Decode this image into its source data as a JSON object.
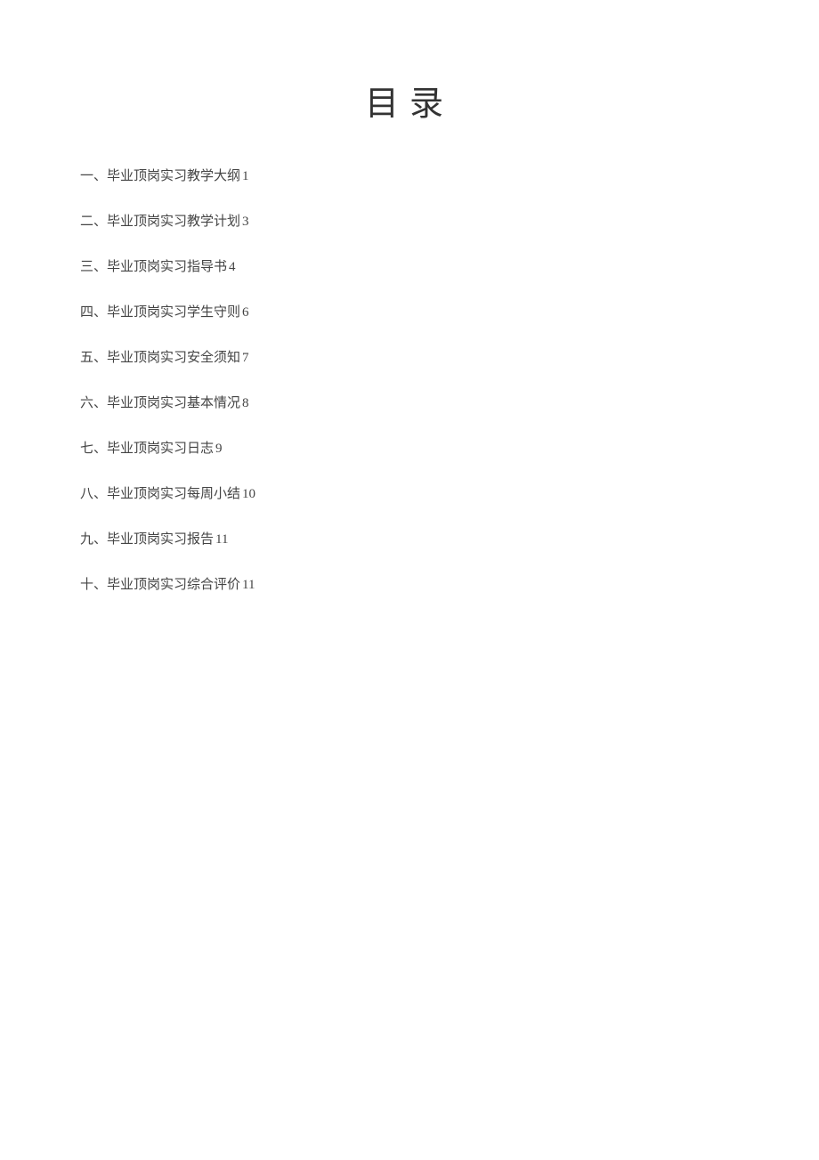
{
  "title": "目录",
  "toc": {
    "items": [
      {
        "label": "一、毕业顶岗实习教学大纲",
        "page": "1"
      },
      {
        "label": "二、毕业顶岗实习教学计划",
        "page": "3"
      },
      {
        "label": "三、毕业顶岗实习指导书",
        "page": "4"
      },
      {
        "label": "四、毕业顶岗实习学生守则",
        "page": "6"
      },
      {
        "label": "五、毕业顶岗实习安全须知",
        "page": "7"
      },
      {
        "label": "六、毕业顶岗实习基本情况",
        "page": "8"
      },
      {
        "label": "七、毕业顶岗实习日志",
        "page": "9"
      },
      {
        "label": "八、毕业顶岗实习每周小结",
        "page": "10"
      },
      {
        "label": "九、毕业顶岗实习报告",
        "page": "11"
      },
      {
        "label": "十、毕业顶岗实习综合评价",
        "page": "11"
      }
    ]
  }
}
